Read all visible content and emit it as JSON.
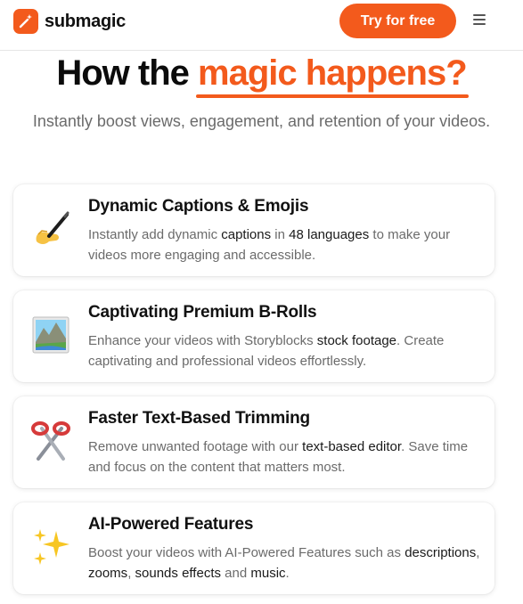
{
  "header": {
    "logo_text": "submagic",
    "cta_label": "Try for free"
  },
  "hero": {
    "title_prefix": "How the ",
    "title_accent": "magic happens?",
    "subtitle": "Instantly boost views, engagement, and retention of your videos."
  },
  "features": [
    {
      "icon": "writing-hand-icon",
      "title": "Dynamic Captions & Emojis",
      "desc_parts": [
        "Instantly add dynamic ",
        "captions",
        " in ",
        "48 languages",
        " to make your videos more engaging and accessible."
      ]
    },
    {
      "icon": "landscape-picture-icon",
      "title": "Captivating Premium B-Rolls",
      "desc_parts": [
        "Enhance your videos with Storyblocks ",
        "stock footage",
        ". Create captivating and professional videos effortlessly."
      ]
    },
    {
      "icon": "scissors-icon",
      "title": "Faster Text-Based Trimming",
      "desc_parts": [
        "Remove unwanted footage with our ",
        "text-based editor",
        ". Save time and focus on the content that matters most."
      ]
    },
    {
      "icon": "sparkles-icon",
      "title": "AI-Powered Features",
      "desc_parts": [
        "Boost your videos with AI-Powered Features such as ",
        "descriptions",
        ", ",
        "zooms",
        ", ",
        "sounds effects",
        " and ",
        "music",
        "."
      ]
    }
  ],
  "colors": {
    "brand": "#f35a1c",
    "text_muted": "#6b6b6b",
    "text_dark": "#111111"
  }
}
